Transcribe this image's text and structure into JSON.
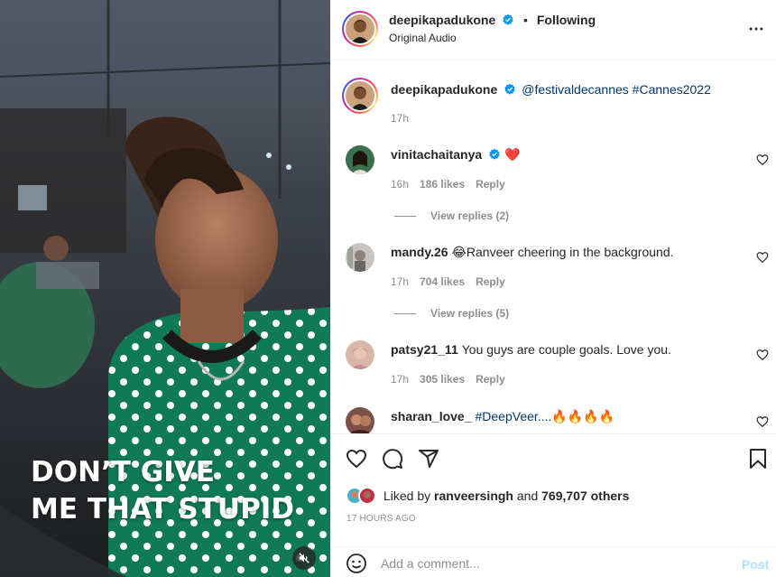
{
  "video": {
    "caption_line1": "DON’T GIVE",
    "caption_line2": "ME THAT STUPID",
    "mute_icon": "speaker-muted-icon"
  },
  "header": {
    "username": "deepikapadukone",
    "verified_icon": "verified-badge-icon",
    "dot": "•",
    "following_label": "Following",
    "audio_label": "Original Audio",
    "more_icon": "more-options-icon"
  },
  "caption": {
    "username": "deepikapadukone",
    "mention": "@festivaldecannes",
    "hashtag": "#Cannes2022",
    "time": "17h"
  },
  "comments": [
    {
      "username": "vinitachaitanya",
      "verified": true,
      "text": "❤️",
      "time": "16h",
      "likes": "186 likes",
      "reply": "Reply",
      "view_replies": "View replies (2)"
    },
    {
      "username": "mandy.26",
      "verified": false,
      "text": "😂Ranveer cheering in the background.",
      "time": "17h",
      "likes": "704 likes",
      "reply": "Reply",
      "view_replies": "View replies (5)"
    },
    {
      "username": "patsy21_11",
      "verified": false,
      "text": "You guys are couple goals. Love you.",
      "time": "17h",
      "likes": "305 likes",
      "reply": "Reply"
    },
    {
      "username": "sharan_love_",
      "verified": false,
      "hashtag": "#DeepVeer....",
      "text": "🔥🔥🔥🔥"
    }
  ],
  "actions": {
    "like_icon": "heart-icon",
    "comment_icon": "comment-icon",
    "share_icon": "share-icon",
    "save_icon": "bookmark-icon"
  },
  "likes": {
    "prefix": "Liked by",
    "user": "ranveersingh",
    "and": "and",
    "others": "769,707 others"
  },
  "timestamp": "17 HOURS AGO",
  "comment_box": {
    "emoji_icon": "emoji-icon",
    "placeholder": "Add a comment...",
    "post_label": "Post"
  },
  "colors": {
    "accent_link": "#00376b",
    "post_disabled": "#b2dffc",
    "verified_blue": "#0095f6",
    "shirt_green": "#0f7a55"
  }
}
